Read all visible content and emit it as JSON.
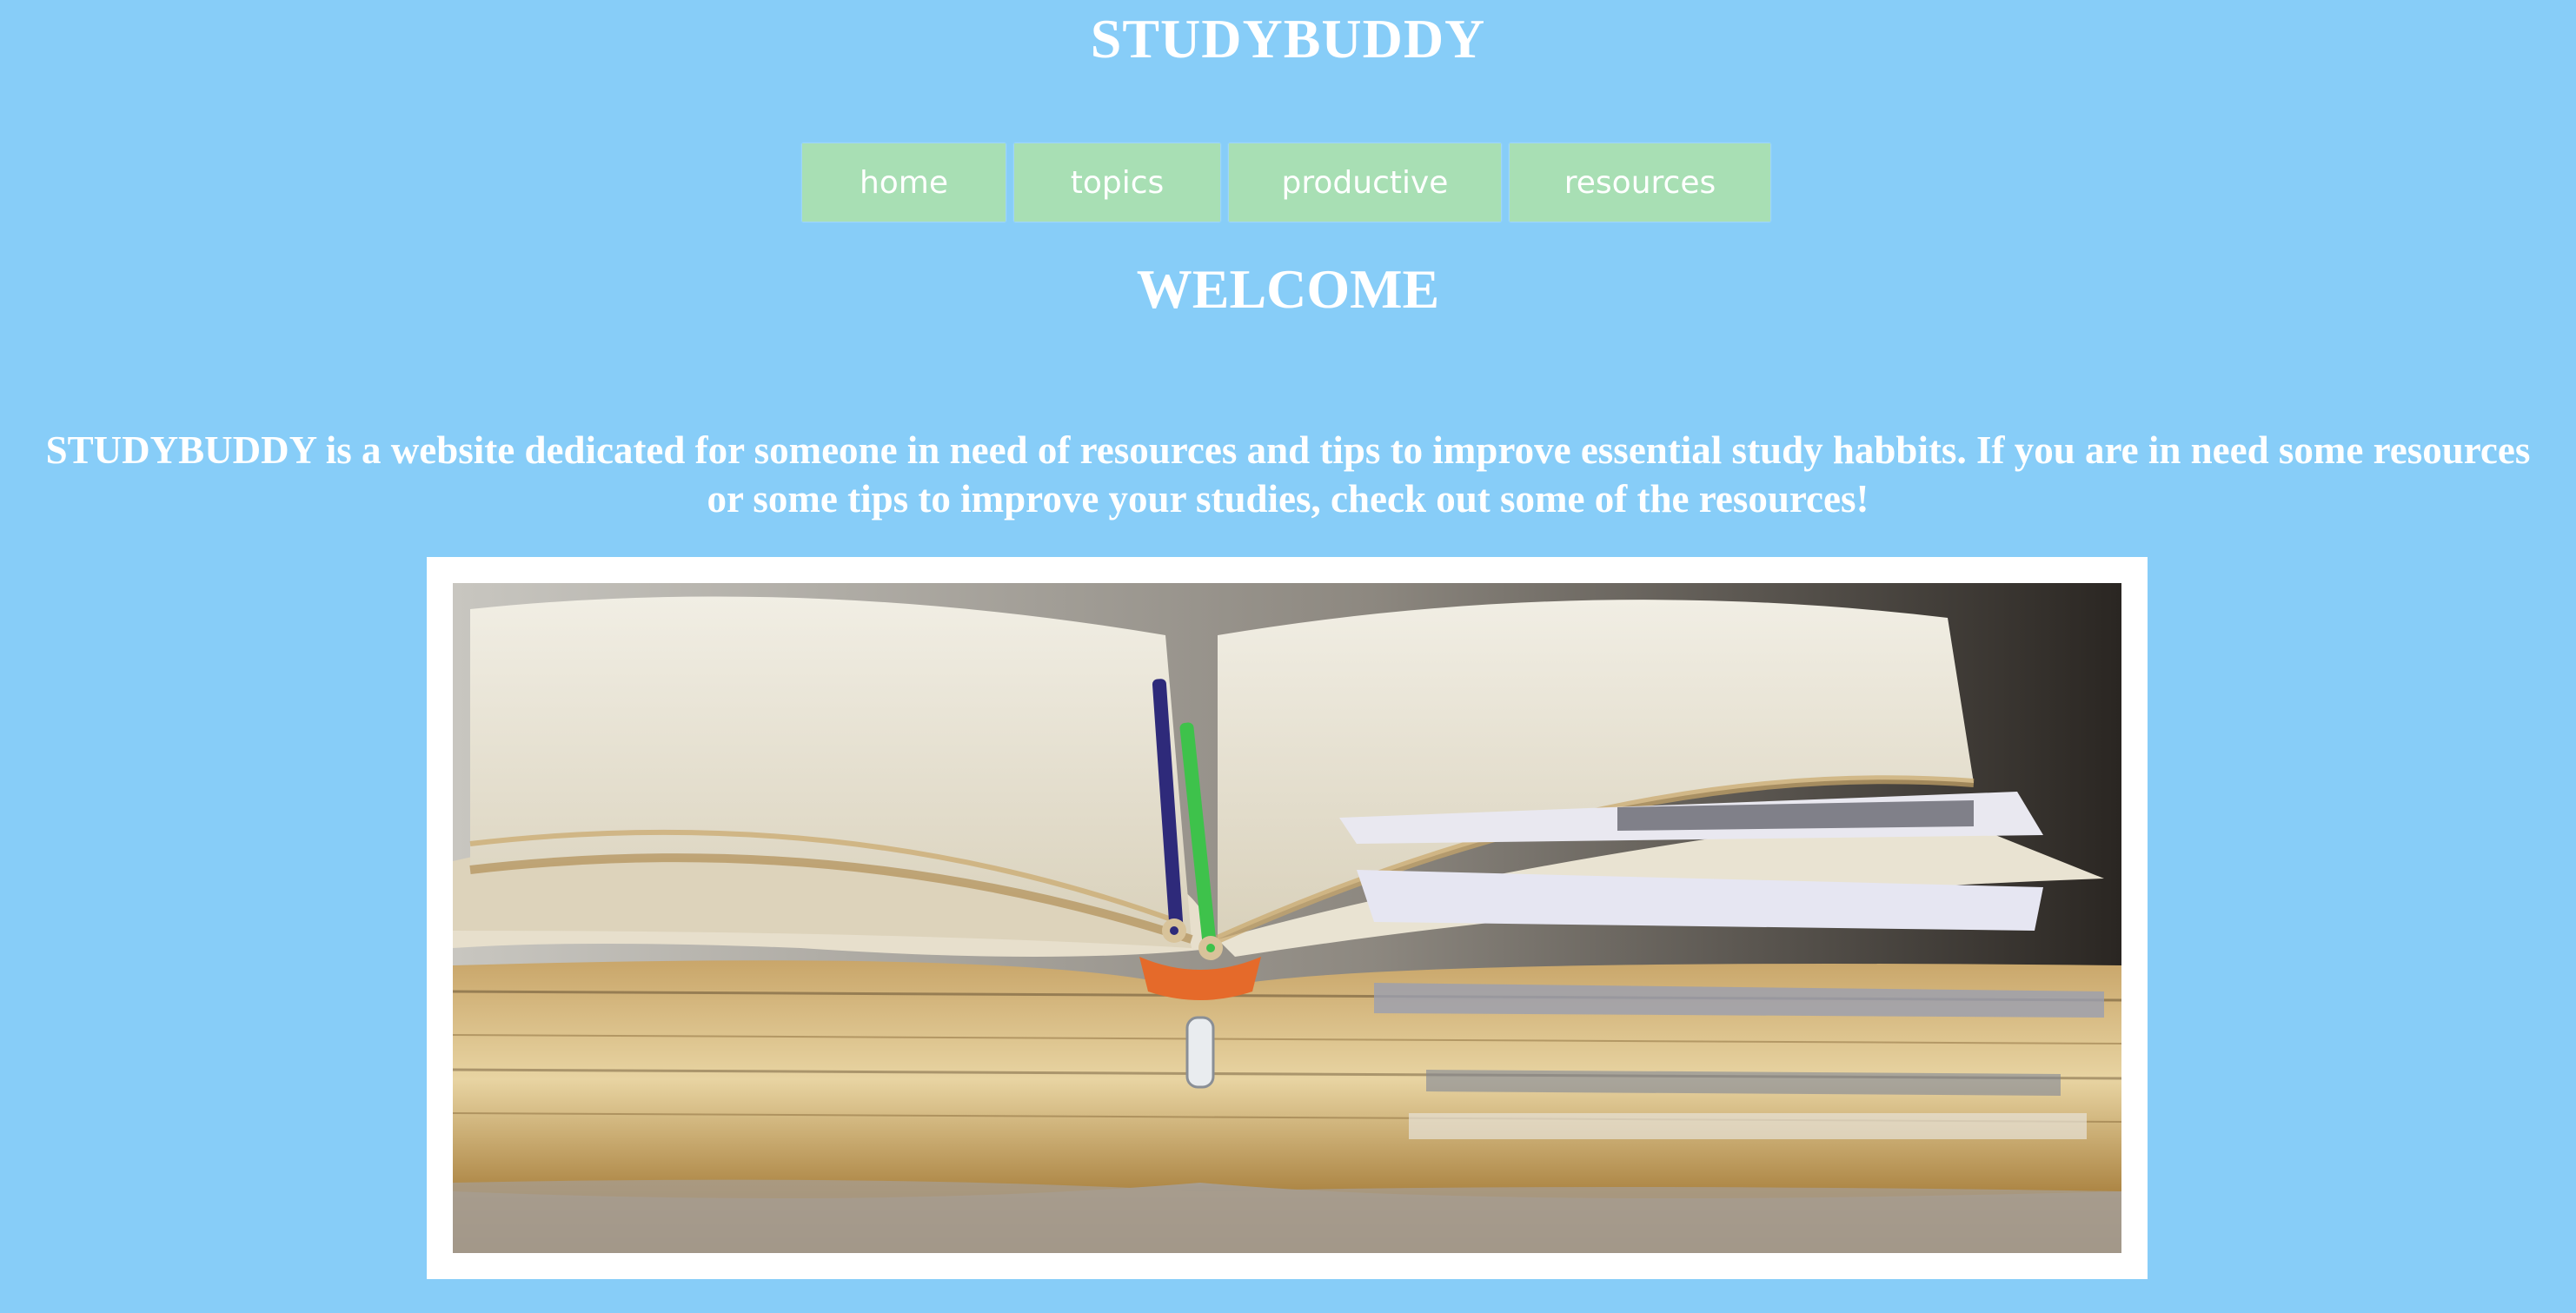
{
  "header": {
    "site_title": "STUDYBUDDY"
  },
  "nav": {
    "items": [
      {
        "label": "home"
      },
      {
        "label": "topics"
      },
      {
        "label": "productive"
      },
      {
        "label": "resources"
      }
    ]
  },
  "main": {
    "welcome_heading": "WELCOME",
    "intro_text": "STUDYBUDDY is a website dedicated for someone in need of resources and tips to improve essential study habbits. If you are in need some resources or some tips to improve your studies, check out some of the resources!",
    "hero_image_subject": "open-books-with-pencils"
  },
  "colors": {
    "page_background": "#87cdf8",
    "nav_button_background": "#a8dfb4",
    "text": "#ffffff",
    "image_frame": "#ffffff"
  }
}
